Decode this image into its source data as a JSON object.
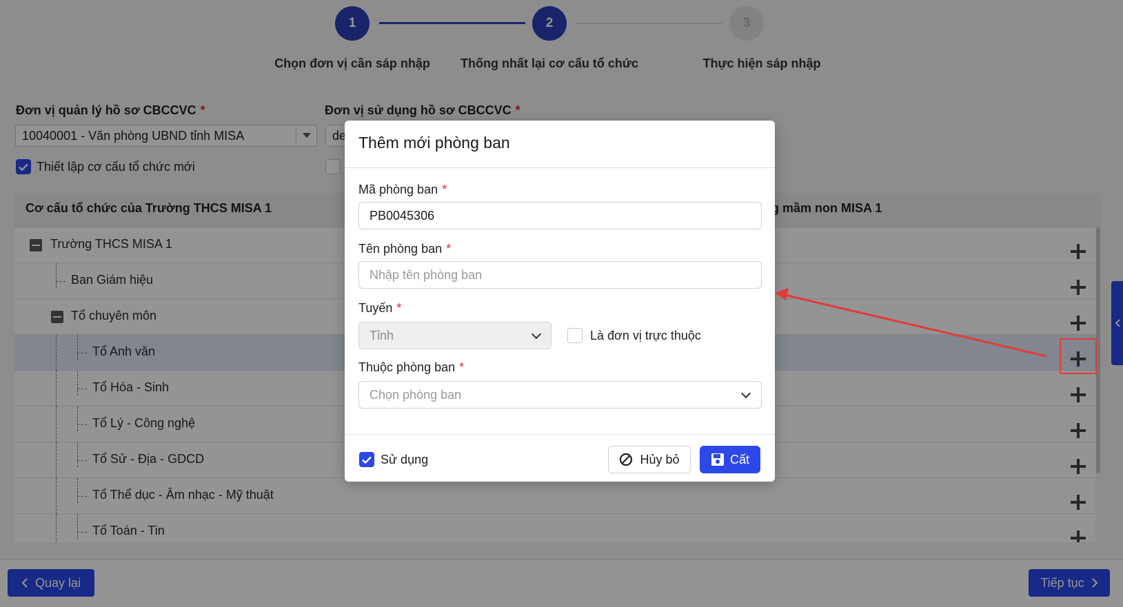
{
  "stepper": {
    "steps": [
      {
        "number": "1",
        "label": "Chọn đơn vị cần sáp nhập"
      },
      {
        "number": "2",
        "label": "Thống nhất lại cơ cấu tổ chức"
      },
      {
        "number": "3",
        "label": "Thực hiện sáp nhập"
      }
    ]
  },
  "form": {
    "manage_label": "Đơn vị quản lý hồ sơ CBCCVC",
    "manage_value": "10040001 - Văn phòng UBND tỉnh MISA",
    "use_label": "Đơn vị sử dụng hồ sơ CBCCVC",
    "use_value": "de",
    "new_structure_label": "Thiết lập cơ cấu tổ chức mới",
    "required_mark": "*"
  },
  "tree": {
    "left_title": "Cơ cấu tổ chức của Trường THCS MISA 1",
    "right_title_partial": "g mầm non MISA 1",
    "rows": [
      {
        "label": "Trường THCS MISA 1"
      },
      {
        "label": "Ban Giám hiệu"
      },
      {
        "label": "Tổ chuyên môn"
      },
      {
        "label": "Tổ Anh văn"
      },
      {
        "label": "Tổ Hóa - Sinh"
      },
      {
        "label": "Tổ Lý - Công nghệ"
      },
      {
        "label": "Tổ Sử - Địa - GDCD"
      },
      {
        "label": "Tổ Thể dục - Âm nhạc - Mỹ thuật"
      },
      {
        "label": "Tổ Toán - Tin"
      }
    ]
  },
  "footer": {
    "back_label": "Quay lại",
    "next_label": "Tiếp tục"
  },
  "modal": {
    "title": "Thêm mới phòng ban",
    "code_label": "Mã phòng ban",
    "code_value": "PB0045306",
    "name_label": "Tên phòng ban",
    "name_placeholder": "Nhập tên phòng ban",
    "tier_label": "Tuyến",
    "tier_value": "Tỉnh",
    "subunit_label": "Là đơn vị trực thuộc",
    "parent_label": "Thuộc phòng ban",
    "parent_placeholder": "Chọn phòng ban",
    "use_label": "Sử dụng",
    "cancel_label": "Hủy bỏ",
    "save_label": "Cất"
  },
  "colors": {
    "accent": "#2c48e8",
    "step_active": "#2c3fb8",
    "required": "#e0292e",
    "annotation": "#e23b3b"
  }
}
